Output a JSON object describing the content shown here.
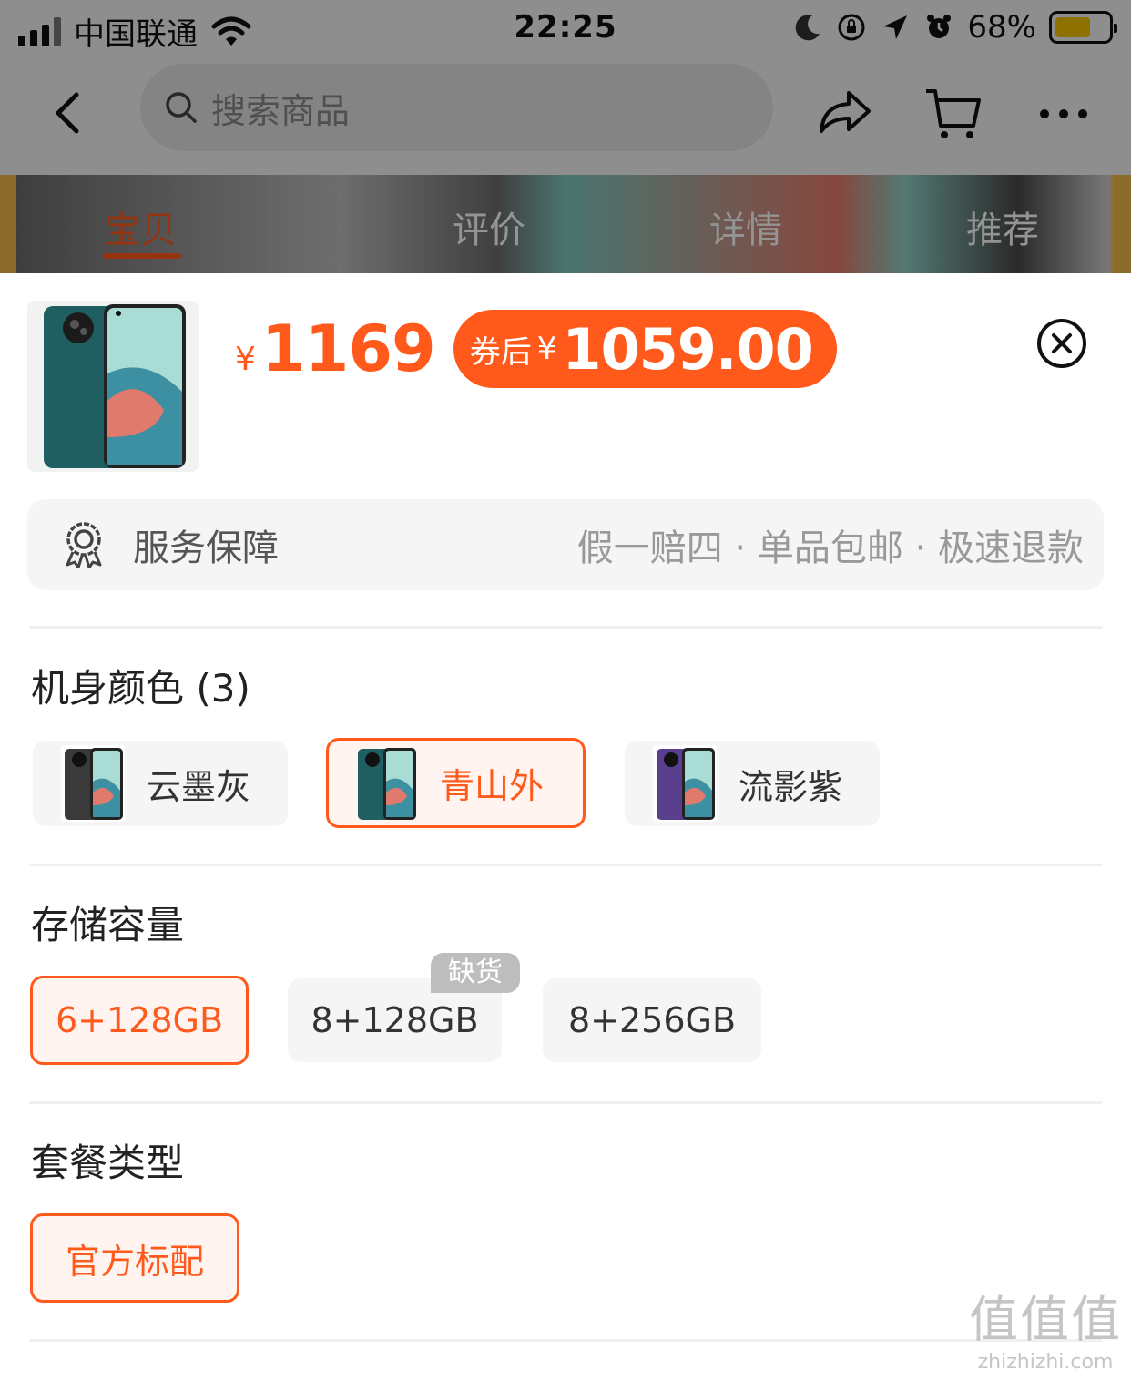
{
  "status_bar": {
    "carrier": "中国联通",
    "time": "22:25",
    "battery_percent": "68%",
    "battery_level": 0.68,
    "icons": [
      "signal-icon",
      "wifi-icon",
      "moon-icon",
      "rotation-lock-icon",
      "location-arrow-icon",
      "alarm-icon",
      "battery-icon"
    ]
  },
  "nav": {
    "search_placeholder": "搜索商品",
    "icons": [
      "back-icon",
      "search-icon",
      "share-icon",
      "cart-icon",
      "more-icon"
    ]
  },
  "tabs": [
    {
      "label": "宝贝",
      "active": true
    },
    {
      "label": "评价",
      "active": false
    },
    {
      "label": "详情",
      "active": false
    },
    {
      "label": "推荐",
      "active": false
    }
  ],
  "product": {
    "currency": "¥",
    "price": "1169",
    "coupon_label": "券后",
    "coupon_currency": "¥",
    "coupon_price": "1059.00"
  },
  "service": {
    "title": "服务保障",
    "desc": "假一赔四 · 单品包邮 · 极速退款"
  },
  "sections": {
    "color": {
      "title": "机身颜色 (3)",
      "options": [
        {
          "label": "云墨灰",
          "selected": false
        },
        {
          "label": "青山外",
          "selected": true
        },
        {
          "label": "流影紫",
          "selected": false
        }
      ]
    },
    "storage": {
      "title": "存储容量",
      "options": [
        {
          "label": "6+128GB",
          "selected": true
        },
        {
          "label": "8+128GB",
          "selected": false,
          "badge": "缺货"
        },
        {
          "label": "8+256GB",
          "selected": false
        }
      ]
    },
    "package": {
      "title": "套餐类型",
      "options": [
        {
          "label": "官方标配",
          "selected": true
        }
      ]
    }
  },
  "colors": {
    "accent": "#ff5a1c",
    "selected_bg": "#fff4f0",
    "option_bg": "#f5f5f5"
  },
  "watermark": {
    "mark": "值值值",
    "site": "zhizhizhi.com"
  }
}
